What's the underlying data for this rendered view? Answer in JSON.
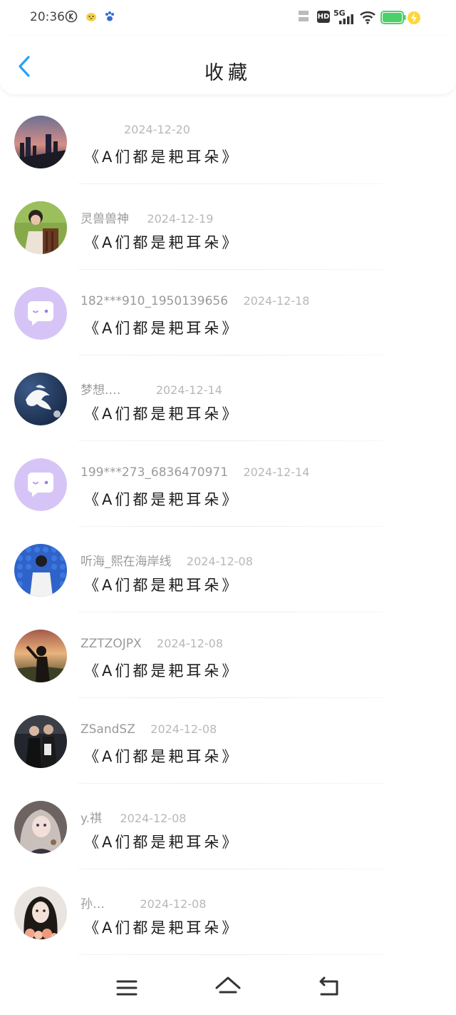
{
  "status": {
    "time": "20:36",
    "hd_label": "HD",
    "net_label": "5G"
  },
  "header": {
    "title": "收藏",
    "back_icon": "chevron-left-icon"
  },
  "favorites": [
    {
      "user": "",
      "date": "2024-12-20",
      "book": "《A们都是耙耳朵》",
      "avatar": "city-night"
    },
    {
      "user": "灵兽兽神",
      "date": "2024-12-19",
      "book": "《A们都是耙耳朵》",
      "avatar": "boy-chair"
    },
    {
      "user": "182***910_1950139656",
      "date": "2024-12-18",
      "book": "《A们都是耙耳朵》",
      "avatar": "default-chat"
    },
    {
      "user": "梦想.…",
      "date": "2024-12-14",
      "book": "《A们都是耙耳朵》",
      "avatar": "white-dove"
    },
    {
      "user": "199***273_6836470971",
      "date": "2024-12-14",
      "book": "《A们都是耙耳朵》",
      "avatar": "default-chat"
    },
    {
      "user": "听海_熙在海岸线",
      "date": "2024-12-08",
      "book": "《A们都是耙耳朵》",
      "avatar": "blue-wall"
    },
    {
      "user": "ZZTZOJPX",
      "date": "2024-12-08",
      "book": "《A们都是耙耳朵》",
      "avatar": "sunset-girl"
    },
    {
      "user": "ZSandSZ",
      "date": "2024-12-08",
      "book": "《A们都是耙耳朵》",
      "avatar": "two-people"
    },
    {
      "user": "y.祺",
      "date": "2024-12-08",
      "book": "《A们都是耙耳朵》",
      "avatar": "anime-girl"
    },
    {
      "user": "孙…",
      "date": "2024-12-08",
      "book": "《A们都是耙耳朵》",
      "avatar": "girl-flowers"
    }
  ],
  "colors": {
    "accent": "#2aa1f0",
    "default_avatar": "#d7c4f7",
    "date_text": "#b8b8b8"
  },
  "navbar": {
    "menu_icon": "menu-icon",
    "home_icon": "home-icon",
    "back_icon": "back-icon"
  }
}
